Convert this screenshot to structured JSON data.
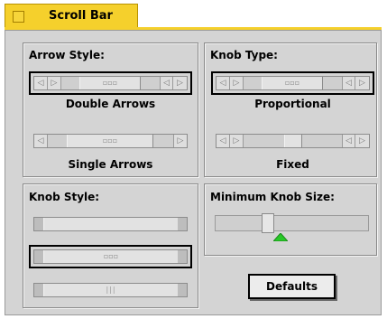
{
  "tab": {
    "label": "Scroll Bar"
  },
  "arrow_style": {
    "title": "Arrow Style:",
    "options": [
      {
        "label": "Double Arrows",
        "selected": true
      },
      {
        "label": "Single Arrows",
        "selected": false
      }
    ]
  },
  "knob_type": {
    "title": "Knob Type:",
    "options": [
      {
        "label": "Proportional",
        "selected": true
      },
      {
        "label": "Fixed",
        "selected": false
      }
    ]
  },
  "knob_style": {
    "title": "Knob Style:",
    "options": [
      {
        "style": "plain",
        "selected": false
      },
      {
        "style": "dots",
        "selected": true
      },
      {
        "style": "lines",
        "selected": false
      }
    ]
  },
  "minimum_knob_size": {
    "title": "Minimum Knob Size:",
    "value": 0.3
  },
  "buttons": {
    "defaults": "Defaults"
  },
  "colors": {
    "tab": "#f5d02c",
    "panel": "#d4d4d4",
    "slider_marker": "#27c827"
  }
}
